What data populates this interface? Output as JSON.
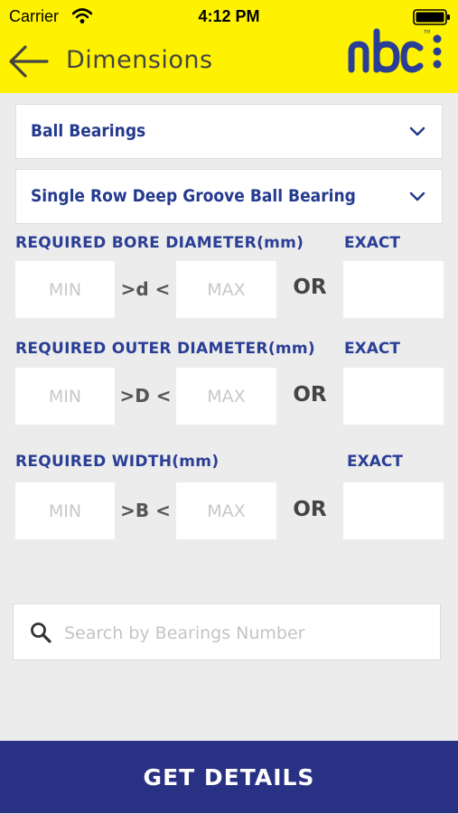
{
  "status_bar": {
    "carrier": "Carrier",
    "time": "4:12 PM",
    "wifi_icon": "wifi-icon",
    "battery_icon": "battery-icon"
  },
  "header": {
    "title": "Dimensions",
    "back_icon": "arrow-left-icon",
    "logo_text": "nbc",
    "background_color": "#fff200"
  },
  "dropdowns": [
    {
      "value": "Ball Bearings",
      "icon": "chevron-down-icon"
    },
    {
      "value": "Single Row Deep Groove Ball Bearing",
      "icon": "chevron-down-icon"
    }
  ],
  "filters": [
    {
      "label": "REQUIRED BORE DIAMETER(mm)",
      "exact_label": "EXACT",
      "min_placeholder": "MIN",
      "symbol": ">d <",
      "max_placeholder": "MAX",
      "or_label": "OR",
      "exact_value": ""
    },
    {
      "label": "REQUIRED OUTER DIAMETER(mm)",
      "exact_label": "EXACT",
      "min_placeholder": "MIN",
      "symbol": ">D <",
      "max_placeholder": "MAX",
      "or_label": "OR",
      "exact_value": ""
    },
    {
      "label": "REQUIRED WIDTH(mm)",
      "exact_label": "EXACT",
      "min_placeholder": "MIN",
      "symbol": ">B <",
      "max_placeholder": "MAX",
      "or_label": "OR",
      "exact_value": ""
    }
  ],
  "search": {
    "placeholder": "Search by Bearings Number",
    "value": "",
    "icon": "search-icon"
  },
  "action": {
    "label": "GET DETAILS",
    "color": "#283183"
  }
}
